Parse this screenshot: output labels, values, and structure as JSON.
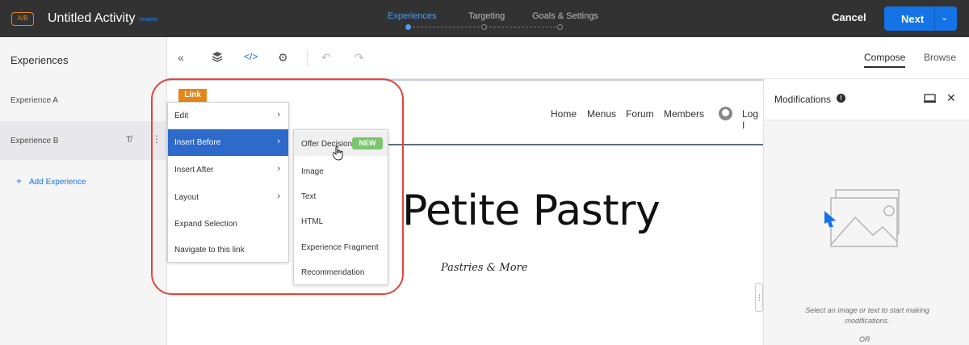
{
  "header": {
    "badge": "A/B",
    "title": "Untitled Activity",
    "subtitle": "rename",
    "steps": [
      {
        "label": "Experiences",
        "active": true
      },
      {
        "label": "Targeting",
        "active": false
      },
      {
        "label": "Goals & Settings",
        "active": false
      }
    ],
    "cancel_label": "Cancel",
    "next_label": "Next"
  },
  "sidebar": {
    "title": "Experiences",
    "items": [
      {
        "label": "Experience A",
        "selected": false
      },
      {
        "label": "Experience B",
        "selected": true
      }
    ],
    "add_label": "Add Experience"
  },
  "toolbar": {
    "modes": {
      "compose": "Compose",
      "browse": "Browse"
    }
  },
  "site": {
    "nav": [
      "Home",
      "Menus",
      "Forum",
      "Members"
    ],
    "login": "Log I",
    "brand": "Petite Pastry",
    "tagline": "Pastries & More"
  },
  "element_tag": "Link",
  "context_menu": {
    "items": [
      {
        "label": "Edit",
        "has_submenu": true
      },
      {
        "label": "Insert Before",
        "has_submenu": true,
        "highlighted": true
      },
      {
        "label": "Insert After",
        "has_submenu": true
      },
      {
        "label": "Layout",
        "has_submenu": true
      },
      {
        "label": "Expand Selection",
        "has_submenu": false
      },
      {
        "label": "Navigate to this link",
        "has_submenu": false
      }
    ]
  },
  "submenu": {
    "items": [
      {
        "label": "Offer Decision",
        "badge": "NEW"
      },
      {
        "label": "Image"
      },
      {
        "label": "Text"
      },
      {
        "label": "HTML"
      },
      {
        "label": "Experience Fragment"
      },
      {
        "label": "Recommendation"
      }
    ]
  },
  "modifications": {
    "title": "Modifications",
    "hint": "Select an image or text to start making modifications.",
    "or": "OR"
  },
  "colors": {
    "accent_blue": "#1473e6",
    "highlight_menu": "#2d6ac9",
    "badge_orange": "#e68619",
    "new_green": "#7dc56f",
    "ring_red": "#e8423a"
  },
  "icons": [
    "collapse-icon",
    "layers-icon",
    "code-icon",
    "settings-icon",
    "undo-icon",
    "redo-icon",
    "info-icon",
    "monitor-icon",
    "close-icon",
    "image-placeholder-icon",
    "cursor-icon"
  ]
}
